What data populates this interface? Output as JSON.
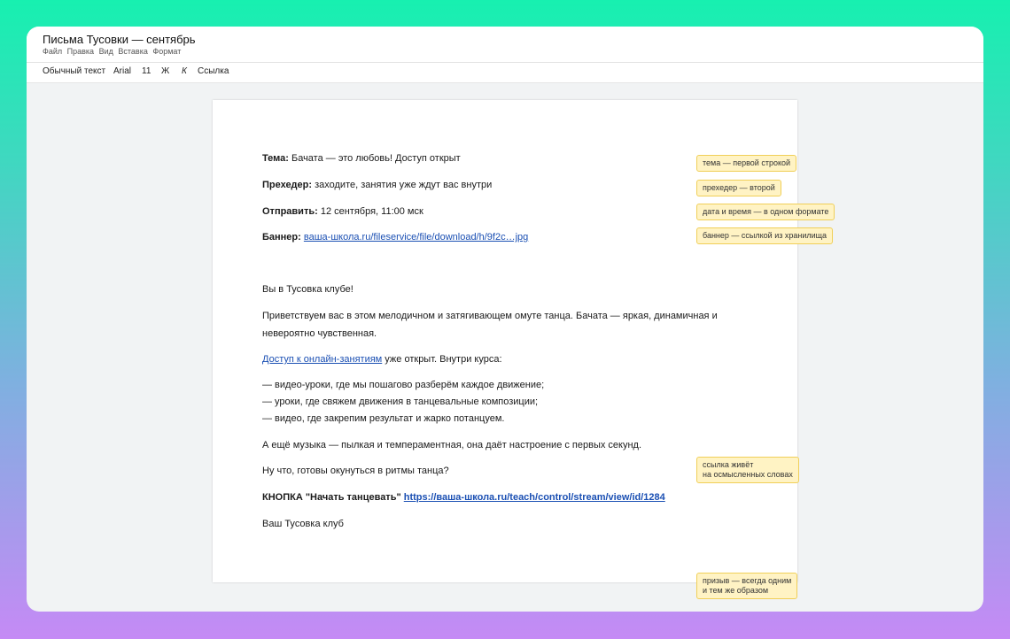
{
  "app": {
    "title": "Письма Тусовки — сентябрь",
    "menu": [
      "Файл",
      "Правка",
      "Вид",
      "Вставка",
      "Формат"
    ]
  },
  "toolbar": {
    "style": "Обычный текст",
    "font": "Arial",
    "size": "11",
    "bold": "Ж",
    "italic": "К",
    "link": "Ссылка"
  },
  "header": {
    "subject_label": "Тема:",
    "subject_value": " Бачата — это любовь! Доступ открыт",
    "preheader_label": "Прехедер:",
    "preheader_value": " заходите, занятия уже ждут вас внутри",
    "send_label": "Отправить:",
    "send_value": " 12 сентября, 11:00 мск",
    "banner_label": "Баннер:",
    "banner_link": "ваша-школа.ru/fileservice/file/download/h/9f2c…jpg"
  },
  "body": {
    "greeting": "Вы в Тусовка клубе!",
    "intro_line1": "Приветствуем вас в этом мелодичном и затягивающем омуте танца. Бачата — яркая, динамичная и",
    "intro_line2": "невероятно чувственная.",
    "access_link": "Доступ к онлайн-занятиям",
    "access_rest": " уже открыт. Внутри курса:",
    "bullets": [
      "— видео-уроки, где мы пошагово разберём каждое движение;",
      "— уроки, где свяжем движения в танцевальные композиции;",
      "— видео, где закрепим результат и жарко потанцуем."
    ],
    "music": "А ещё музыка — пылкая и темпераментная, она даёт настроение с первых секунд.",
    "question": "Ну что, готовы окунуться в ритмы танца?",
    "cta_label": "КНОПКА \"Начать танцевать\"",
    "cta_link": "https://ваша-школа.ru/teach/control/stream/view/id/1284",
    "signature": "Ваш Тусовка клуб"
  },
  "notes": {
    "subject": "тема — первой строкой",
    "preheader": "прехедер — второй",
    "datetime": "дата и время — в одном формате",
    "banner": "баннер — ссылкой из хранилища",
    "link_line1": "ссылка живёт",
    "link_line2": "на осмысленных словах",
    "cta_line1": "призыв — всегда одним",
    "cta_line2": "и тем же образом"
  },
  "colors": {
    "link": "#1a4fb3",
    "note_bg": "#fff3c4",
    "note_border": "#f0cf58"
  }
}
